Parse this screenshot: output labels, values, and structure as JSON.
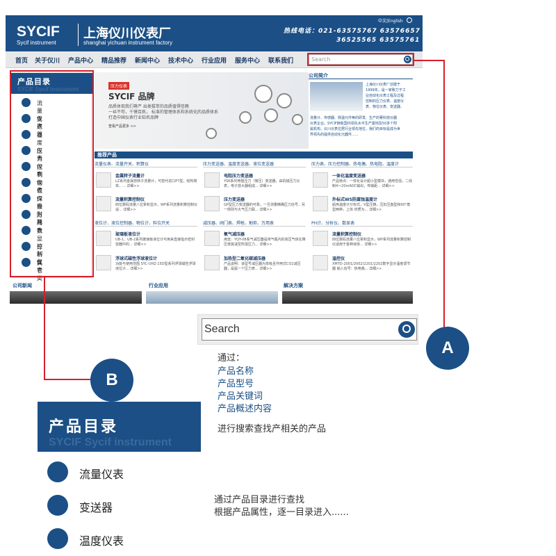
{
  "header": {
    "logo_en": "SYCIF",
    "logo_en_sub": "Sycif instrument",
    "logo_cn": "上海仪川仪表厂",
    "logo_cn_sub": "shanghai yichuan instrument factory",
    "lang": "中文|English",
    "hotline": "热线电话：021-63575767  63576657",
    "hotline2": "36525565  63575761"
  },
  "nav": {
    "items": [
      "首页",
      "关于仪川",
      "产品中心",
      "精品推荐",
      "新闻中心",
      "技术中心",
      "行业应用",
      "服务中心",
      "联系我们"
    ]
  },
  "search": {
    "placeholder": "Search"
  },
  "sidebar": {
    "title": "产品目录",
    "watermark": "SYCIF Sycif instrument",
    "items": [
      "流量仪表",
      "变送器",
      "温度仪表",
      "压力仪表",
      "控制仪表",
      "物位仪表",
      "焊接耐耗",
      "万用表",
      "数显控制仪",
      "分析仪表",
      "其它类"
    ]
  },
  "banner": {
    "tag": "压力仪表",
    "title": "SYCIF 品牌",
    "line1": "品质体现我们尊严  出类拔萃的品质值得信赖",
    "line2": "一丝不苟，千锤百炼，    标准的管理体系和系统化的品质体系",
    "line3": "打造中国仪表行业知名品牌",
    "more": "查看产品更多 >>"
  },
  "company": {
    "heading": "公司简介",
    "text1": "上海仪川仪表厂创建于",
    "text2": "1999年，是一家致力于工",
    "text3": "业自动化仪表工程及过程",
    "text4": "控制的压力仪表、温度仪",
    "text5": "表、物位仪表、变送器、",
    "text6": "流量计、传感器、侧温元件等的研发、生产的著科技仪器",
    "text7": "仪表企业。SYCIF拥有国内领先水平生产基地及50多个附",
    "text8": "属机构，仪川仪表位居行业领先地位，我们的目标是成为世",
    "text9": "界领先的提供自动化元器件......"
  },
  "products": {
    "heading": "推荐产品",
    "groups": [
      "流量仪表、流量开关、积算仪",
      "压力变送器、温度变送器、液位变送器",
      "压力表、压力控制器、热电偶、热电阻、温度计",
      "液位计、液位控制器、物位计、料位开关",
      "减压器、阀门表、焊枪、割炬、万用表",
      "PH计、分析仪、数显表"
    ],
    "items": [
      {
        "title": "金属转子流量计",
        "desc": "LZ系列金属管转子流量计，可替代进口P7型，结构简单，...  详细>>"
      },
      {
        "title": "电阻压力变送器",
        "desc": "YSK系列电阻压力（微压）变送器，由机械压力仪表，电子放大器组成...  详细>>"
      },
      {
        "title": "一体化温度变送器",
        "desc": "产品特点：一体化设计超小型模块，通用性强，二线制4～20mADC输出，传输距...  详细>>"
      },
      {
        "title": "流量积算控制仪",
        "desc": "四位数码流量八位累积显示，WP系列流量积算控制仪适...  详细>>"
      },
      {
        "title": "压力变送器",
        "desc": "GP型压力变送器的可靠，一旦测量精确压力信号，另一侧则与大气压力联...  详细>>"
      },
      {
        "title": "外标式WS防腐蚀温度计",
        "desc": "船用温度计分标式，V型压铸，压扣压盘型和90°角型两种，上体 材质为...  详细>>"
      },
      {
        "title": "玻璃板液位计",
        "desc": "UB-1、UB-2系列玻璃板液位计可用来直接指示密封容器中的...  详细>>"
      },
      {
        "title": "氧气减压器",
        "desc": "用途：YQY-08系气减压器是将气瓶内的高压气体在降压使其减至所需压力...  详细>>"
      },
      {
        "title": "流量积算控制仪",
        "desc": "四位数码流量八位累积显示，WP系列流量积算控制仪适用于各种液体...  详细>>"
      },
      {
        "title": "浮球式磁性浮球液位计",
        "desc": "功能与使用范围 SYC-UHZ-15D型系列浮球磁性浮球液位计...  详细>>"
      },
      {
        "title": "加热型二氧化碳减压器",
        "desc": "产品说明：该型号减压器为单级且作用式CO2减压器，是属一个压力表...  详细>>"
      },
      {
        "title": "温控仪",
        "desc": "XMTD-2001/2002/2201/2202数字显示温度调节器 输入信号：热电偶...  详细>>"
      }
    ]
  },
  "bottom": {
    "news": "公司新闻",
    "industry": "行业应用",
    "solutions": "解决方案"
  },
  "callout_a": {
    "label": "A",
    "search_placeholder": "Search",
    "by": "通过：",
    "opts": [
      "产品名称",
      "产品型号",
      "产品关键词",
      "产品概述内容"
    ],
    "desc": "进行搜索查找产相关的产品"
  },
  "callout_b": {
    "label": "B",
    "title": "产品目录",
    "watermark": "SYCIF Sycif instrument",
    "items": [
      "流量仪表",
      "变送器",
      "温度仪表"
    ],
    "desc1": "通过产品目录进行查找",
    "desc2": "根据产品属性，逐一目录进入......"
  },
  "colors": {
    "brand": "#1b4f86",
    "callout": "#d41f2a"
  }
}
